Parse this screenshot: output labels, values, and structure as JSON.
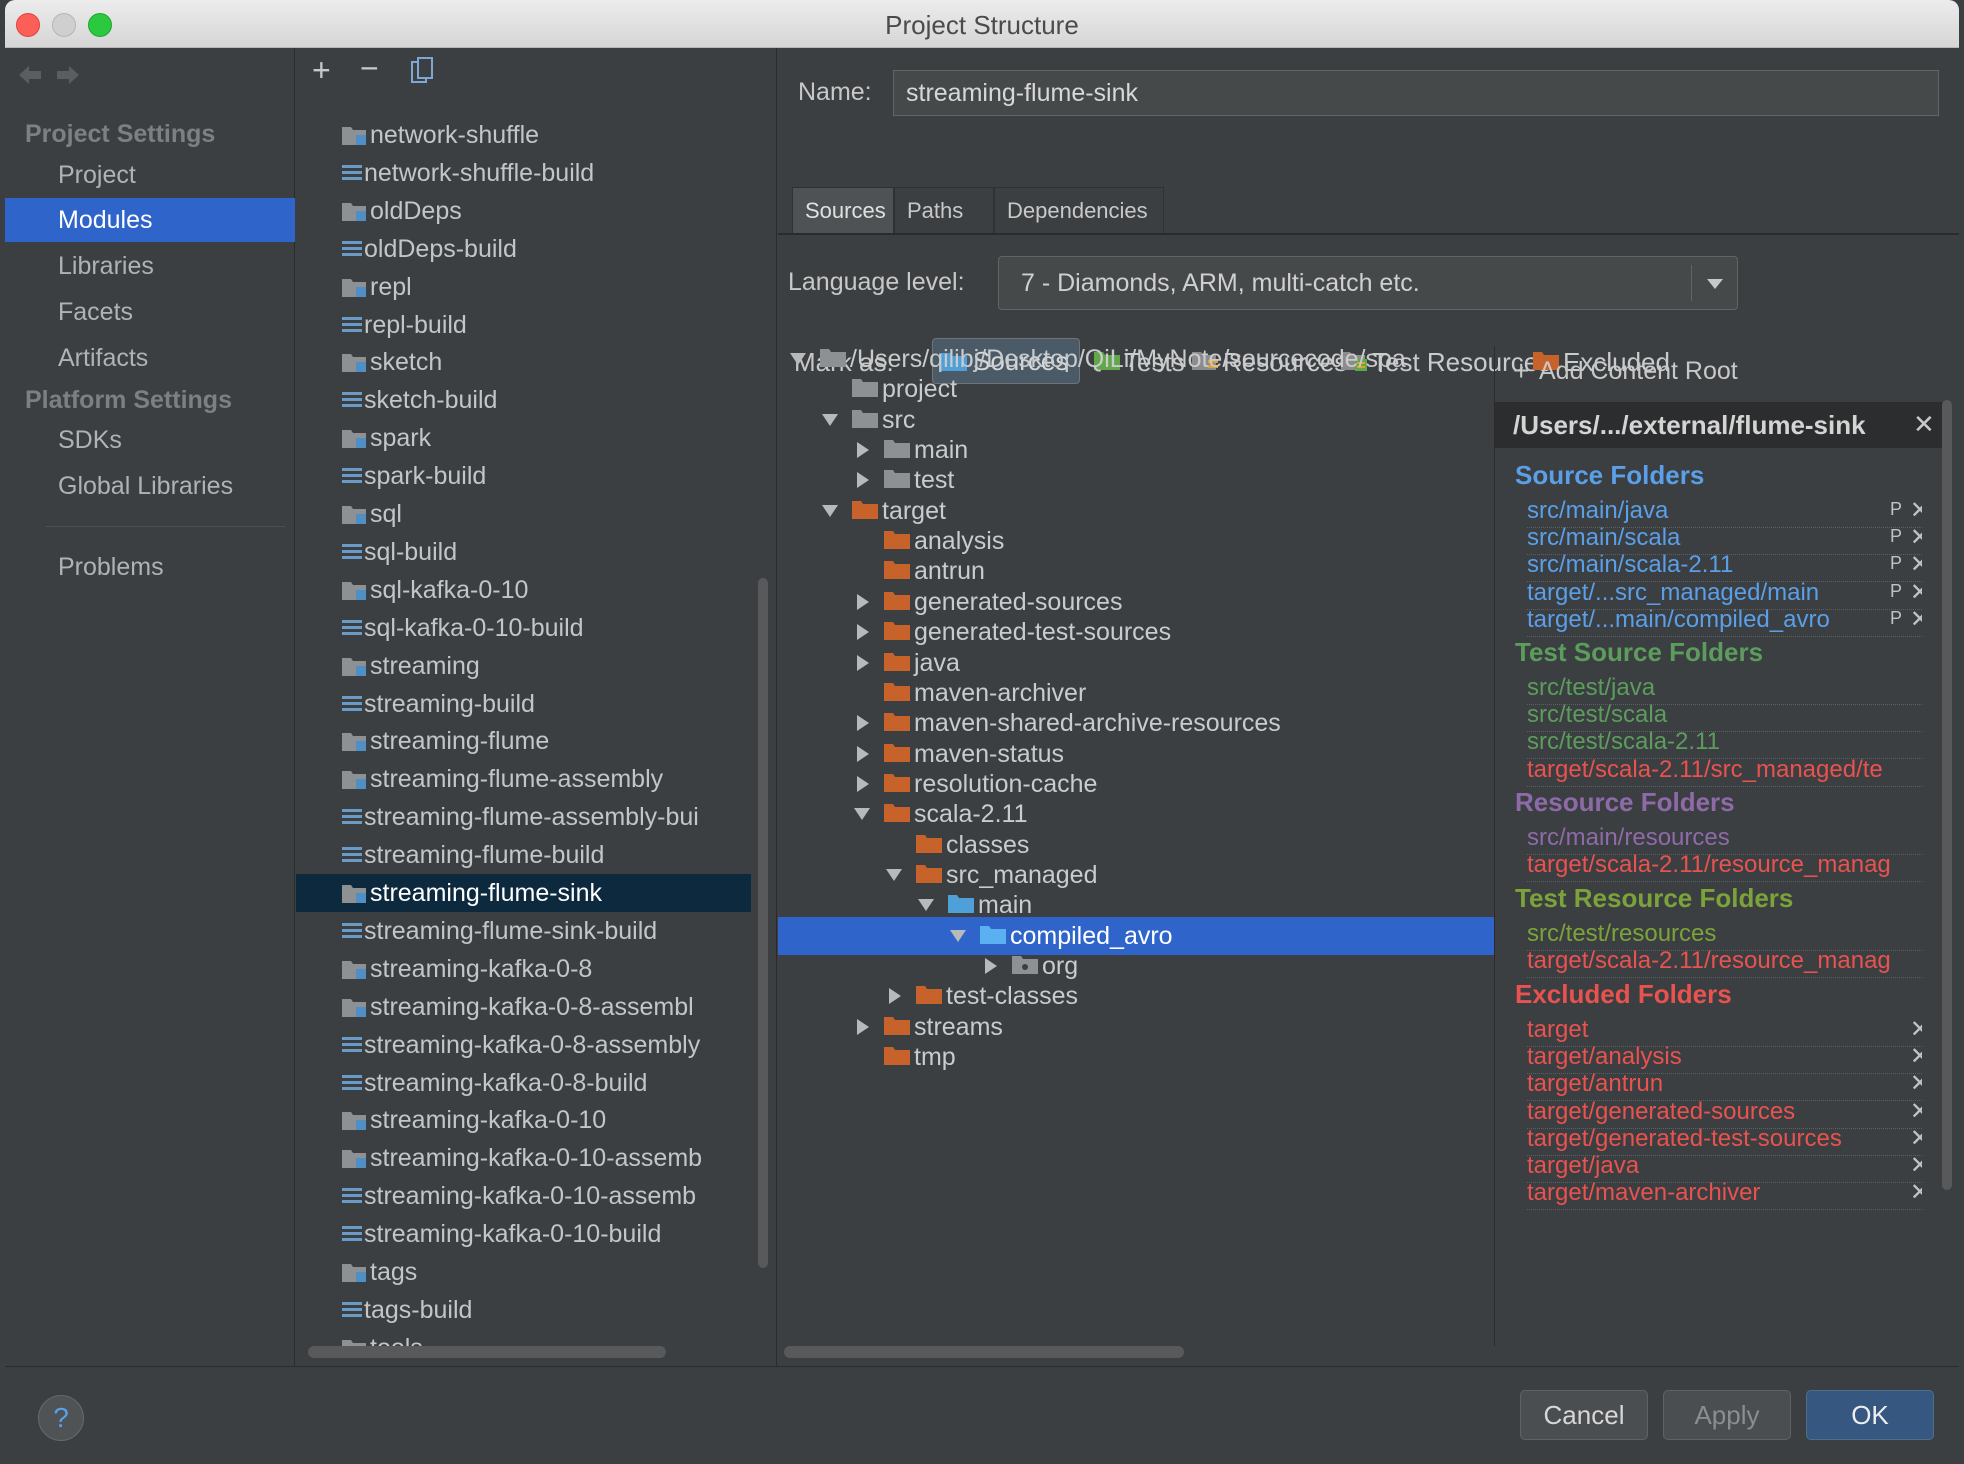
{
  "window": {
    "title": "Project Structure"
  },
  "nav": {
    "back_icon": "arrow-left-icon",
    "forward_icon": "arrow-right-icon"
  },
  "sidebar": {
    "project_settings": "Project Settings",
    "project_items": [
      "Project",
      "Modules",
      "Libraries",
      "Facets",
      "Artifacts"
    ],
    "platform_settings": "Platform Settings",
    "platform_items": [
      "SDKs",
      "Global Libraries"
    ],
    "problems": "Problems",
    "selected": "Modules"
  },
  "modules_toolbar": {
    "add": "+",
    "remove": "−",
    "copy_icon": "copy-icon"
  },
  "modules": [
    {
      "name": "network-shuffle",
      "kind": "module"
    },
    {
      "name": "network-shuffle-build",
      "kind": "lib"
    },
    {
      "name": "oldDeps",
      "kind": "module"
    },
    {
      "name": "oldDeps-build",
      "kind": "lib"
    },
    {
      "name": "repl",
      "kind": "module"
    },
    {
      "name": "repl-build",
      "kind": "lib"
    },
    {
      "name": "sketch",
      "kind": "module"
    },
    {
      "name": "sketch-build",
      "kind": "lib"
    },
    {
      "name": "spark",
      "kind": "module"
    },
    {
      "name": "spark-build",
      "kind": "lib"
    },
    {
      "name": "sql",
      "kind": "module"
    },
    {
      "name": "sql-build",
      "kind": "lib"
    },
    {
      "name": "sql-kafka-0-10",
      "kind": "module"
    },
    {
      "name": "sql-kafka-0-10-build",
      "kind": "lib"
    },
    {
      "name": "streaming",
      "kind": "module"
    },
    {
      "name": "streaming-build",
      "kind": "lib"
    },
    {
      "name": "streaming-flume",
      "kind": "module"
    },
    {
      "name": "streaming-flume-assembly",
      "kind": "module"
    },
    {
      "name": "streaming-flume-assembly-bui",
      "kind": "lib"
    },
    {
      "name": "streaming-flume-build",
      "kind": "lib"
    },
    {
      "name": "streaming-flume-sink",
      "kind": "module",
      "selected": true
    },
    {
      "name": "streaming-flume-sink-build",
      "kind": "lib"
    },
    {
      "name": "streaming-kafka-0-8",
      "kind": "module"
    },
    {
      "name": "streaming-kafka-0-8-assembl",
      "kind": "module"
    },
    {
      "name": "streaming-kafka-0-8-assembly",
      "kind": "lib"
    },
    {
      "name": "streaming-kafka-0-8-build",
      "kind": "lib"
    },
    {
      "name": "streaming-kafka-0-10",
      "kind": "module"
    },
    {
      "name": "streaming-kafka-0-10-assemb",
      "kind": "module"
    },
    {
      "name": "streaming-kafka-0-10-assemb",
      "kind": "lib"
    },
    {
      "name": "streaming-kafka-0-10-build",
      "kind": "lib"
    },
    {
      "name": "tags",
      "kind": "module"
    },
    {
      "name": "tags-build",
      "kind": "lib"
    },
    {
      "name": "tools",
      "kind": "module"
    }
  ],
  "details": {
    "name_label": "Name:",
    "name_value": "streaming-flume-sink",
    "tabs": [
      "Sources",
      "Paths",
      "Dependencies"
    ],
    "active_tab": "Sources",
    "language_label": "Language level:",
    "language_value": "7 - Diamonds, ARM, multi-catch etc.",
    "mark_as_label": "Mark as:",
    "mark_as": [
      {
        "label": "Sources",
        "color": "#4f9fd8",
        "icon": "source-folder-icon"
      },
      {
        "label": "Tests",
        "color": "#62a74a",
        "icon": "test-folder-icon"
      },
      {
        "label": "Resources",
        "color": "#8c8c8c",
        "icon": "resource-folder-icon"
      },
      {
        "label": "Test Resources",
        "color": "#8c8c8c",
        "icon": "test-resource-folder-icon"
      },
      {
        "label": "Excluded",
        "color": "#c7622a",
        "icon": "excluded-folder-icon"
      }
    ]
  },
  "tree": [
    {
      "label": "/Users/qilibj/Desktop/QiLi/MyNote/sourcecode/spa",
      "depth": 0,
      "arrow": "down",
      "color": "grey"
    },
    {
      "label": "project",
      "depth": 1,
      "arrow": "none",
      "color": "grey"
    },
    {
      "label": "src",
      "depth": 1,
      "arrow": "down",
      "color": "grey"
    },
    {
      "label": "main",
      "depth": 2,
      "arrow": "right",
      "color": "grey"
    },
    {
      "label": "test",
      "depth": 2,
      "arrow": "right",
      "color": "grey"
    },
    {
      "label": "target",
      "depth": 1,
      "arrow": "down",
      "color": "orange"
    },
    {
      "label": "analysis",
      "depth": 2,
      "arrow": "none",
      "color": "orange"
    },
    {
      "label": "antrun",
      "depth": 2,
      "arrow": "none",
      "color": "orange"
    },
    {
      "label": "generated-sources",
      "depth": 2,
      "arrow": "right",
      "color": "orange"
    },
    {
      "label": "generated-test-sources",
      "depth": 2,
      "arrow": "right",
      "color": "orange"
    },
    {
      "label": "java",
      "depth": 2,
      "arrow": "right",
      "color": "orange"
    },
    {
      "label": "maven-archiver",
      "depth": 2,
      "arrow": "none",
      "color": "orange"
    },
    {
      "label": "maven-shared-archive-resources",
      "depth": 2,
      "arrow": "right",
      "color": "orange"
    },
    {
      "label": "maven-status",
      "depth": 2,
      "arrow": "right",
      "color": "orange"
    },
    {
      "label": "resolution-cache",
      "depth": 2,
      "arrow": "right",
      "color": "orange"
    },
    {
      "label": "scala-2.11",
      "depth": 2,
      "arrow": "down",
      "color": "orange"
    },
    {
      "label": "classes",
      "depth": 3,
      "arrow": "none",
      "color": "orange"
    },
    {
      "label": "src_managed",
      "depth": 3,
      "arrow": "down",
      "color": "orange"
    },
    {
      "label": "main",
      "depth": 4,
      "arrow": "down",
      "color": "blue"
    },
    {
      "label": "compiled_avro",
      "depth": 5,
      "arrow": "down",
      "color": "blue",
      "selected": true
    },
    {
      "label": "org",
      "depth": 6,
      "arrow": "right",
      "color": "package"
    },
    {
      "label": "test-classes",
      "depth": 3,
      "arrow": "right",
      "color": "orange"
    },
    {
      "label": "streams",
      "depth": 2,
      "arrow": "right",
      "color": "orange"
    },
    {
      "label": "tmp",
      "depth": 2,
      "arrow": "none",
      "color": "orange"
    }
  ],
  "roots": {
    "add_content_root": "Add Content Root",
    "root_path": "/Users/.../external/flume-sink",
    "source_folders": {
      "title": "Source Folders",
      "color": "#5a9fe8",
      "items": [
        "src/main/java",
        "src/main/scala",
        "src/main/scala-2.11",
        "target/...src_managed/main",
        "target/...main/compiled_avro"
      ]
    },
    "test_source_folders": {
      "title": "Test Source Folders",
      "color": "#5c9c5c",
      "items": [
        "src/test/java",
        "src/test/scala",
        "src/test/scala-2.11",
        "target/scala-2.11/src_managed/te"
      ]
    },
    "resource_folders": {
      "title": "Resource Folders",
      "color": "#8e6aa8",
      "items": [
        "src/main/resources",
        "target/scala-2.11/resource_manag"
      ]
    },
    "test_resource_folders": {
      "title": "Test Resource Folders",
      "color": "#7ba33a",
      "items": [
        "src/test/resources",
        "target/scala-2.11/resource_manag"
      ]
    },
    "excluded_folders": {
      "title": "Excluded Folders",
      "color": "#e8524f",
      "items": [
        "target",
        "target/analysis",
        "target/antrun",
        "target/generated-sources",
        "target/generated-test-sources",
        "target/java",
        "target/maven-archiver"
      ]
    },
    "invalid_color": "#e8524f"
  },
  "footer": {
    "help": "?",
    "cancel": "Cancel",
    "apply": "Apply",
    "ok": "OK"
  }
}
